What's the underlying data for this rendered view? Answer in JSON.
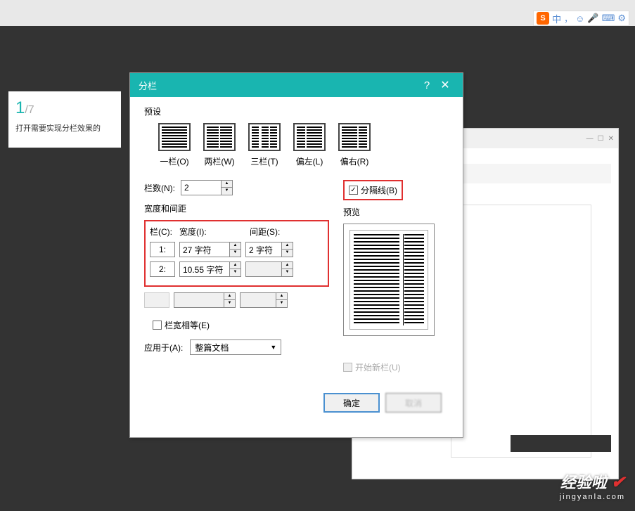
{
  "page": {
    "current": "1",
    "total": "/7",
    "description": "打开需要实现分栏效果的"
  },
  "ime": {
    "logo": "S",
    "lang": "中",
    "punct": "，",
    "face": "☺",
    "mic": "🎤",
    "kbd": "⌨",
    "gear": "⚙"
  },
  "dialog": {
    "title": "分栏",
    "help": "?",
    "close": "✕",
    "preset_label": "预设",
    "presets": {
      "one": "一栏(O)",
      "two": "两栏(W)",
      "three": "三栏(T)",
      "left": "偏左(L)",
      "right": "偏右(R)"
    },
    "col_count_label": "栏数(N):",
    "col_count_value": "2",
    "divider_label": "分隔线(B)",
    "width_section": "宽度和间距",
    "preview_label": "预览",
    "headers": {
      "col": "栏(C):",
      "width": "宽度(I):",
      "spacing": "间距(S):"
    },
    "rows": [
      {
        "num": "1:",
        "width": "27 字符",
        "spacing": "2 字符"
      },
      {
        "num": "2:",
        "width": "10.55 字符",
        "spacing": ""
      }
    ],
    "equal_width": "栏宽相等(E)",
    "apply_label": "应用于(A):",
    "apply_value": "整篇文档",
    "new_col": "开始新栏(U)",
    "ok": "确定",
    "cancel": "取消"
  },
  "watermark": {
    "main": "经验啦",
    "sub": "jingyanla.com"
  }
}
